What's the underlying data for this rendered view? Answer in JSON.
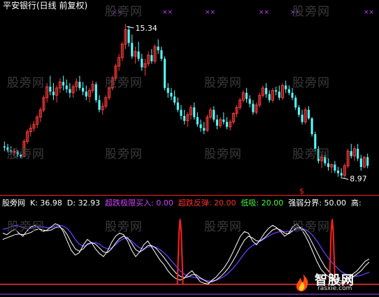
{
  "title": "平安银行(日线 前复权)",
  "watermark": "股旁网",
  "colors": {
    "up": "#ff3b3b",
    "down": "#54ffff",
    "k_line": "#ffffff",
    "d_line": "#ffffff",
    "purple_line": "#6a3cff",
    "spike": "#ff2020",
    "baseline": "#ff3030",
    "sep": "#ff2020",
    "marker": "#c040ff"
  },
  "main_chart": {
    "high_label": "15.34",
    "low_label": "8.97",
    "signal_glyph": "$",
    "top_marker": "××",
    "y_range": [
      8.5,
      15.8
    ],
    "candles": [
      [
        10.3,
        10.5,
        10.1,
        10.25
      ],
      [
        10.25,
        10.4,
        10.05,
        10.15
      ],
      [
        10.15,
        10.3,
        9.95,
        10.05
      ],
      [
        10.05,
        10.2,
        9.9,
        10.1
      ],
      [
        10.1,
        10.15,
        9.85,
        9.95
      ],
      [
        9.95,
        10.05,
        9.8,
        9.88
      ],
      [
        9.88,
        10.6,
        9.85,
        10.5
      ],
      [
        10.5,
        11.0,
        10.4,
        10.9
      ],
      [
        10.9,
        11.2,
        10.7,
        11.05
      ],
      [
        11.05,
        11.35,
        10.9,
        11.2
      ],
      [
        11.2,
        11.6,
        11.05,
        11.5
      ],
      [
        11.5,
        11.9,
        11.3,
        11.8
      ],
      [
        11.8,
        12.4,
        11.7,
        12.3
      ],
      [
        12.3,
        12.9,
        12.1,
        12.75
      ],
      [
        12.75,
        13.2,
        12.4,
        12.55
      ],
      [
        12.55,
        12.9,
        12.2,
        12.4
      ],
      [
        12.4,
        12.8,
        12.1,
        12.7
      ],
      [
        12.7,
        13.1,
        12.5,
        12.95
      ],
      [
        12.95,
        13.2,
        12.6,
        12.8
      ],
      [
        12.8,
        13.05,
        12.5,
        12.65
      ],
      [
        12.65,
        12.9,
        12.3,
        12.5
      ],
      [
        12.5,
        12.85,
        12.3,
        12.75
      ],
      [
        12.75,
        13.1,
        12.55,
        12.95
      ],
      [
        12.95,
        13.2,
        12.6,
        12.7
      ],
      [
        12.7,
        12.95,
        12.4,
        12.55
      ],
      [
        12.55,
        12.8,
        12.2,
        12.35
      ],
      [
        12.35,
        12.7,
        12.1,
        12.6
      ],
      [
        12.6,
        13.0,
        12.5,
        12.85
      ],
      [
        12.85,
        12.95,
        12.1,
        12.2
      ],
      [
        12.2,
        12.4,
        11.7,
        11.8
      ],
      [
        11.8,
        12.1,
        11.6,
        11.95
      ],
      [
        11.95,
        12.4,
        11.85,
        12.3
      ],
      [
        12.3,
        12.8,
        12.2,
        12.7
      ],
      [
        12.7,
        13.2,
        12.6,
        13.1
      ],
      [
        13.1,
        13.7,
        13.0,
        13.6
      ],
      [
        13.6,
        14.1,
        13.4,
        13.95
      ],
      [
        13.95,
        14.6,
        13.8,
        14.5
      ],
      [
        14.5,
        15.34,
        14.3,
        15.1
      ],
      [
        15.1,
        15.25,
        14.4,
        14.55
      ],
      [
        14.55,
        14.9,
        13.9,
        14.0
      ],
      [
        14.0,
        14.4,
        13.7,
        14.2
      ],
      [
        14.2,
        14.6,
        13.8,
        13.9
      ],
      [
        13.9,
        14.1,
        13.4,
        13.55
      ],
      [
        13.55,
        13.9,
        13.2,
        13.7
      ],
      [
        13.7,
        14.2,
        13.6,
        14.05
      ],
      [
        14.05,
        14.3,
        13.7,
        13.8
      ],
      [
        13.8,
        14.5,
        13.7,
        14.4
      ],
      [
        14.4,
        14.7,
        14.1,
        14.25
      ],
      [
        14.25,
        14.4,
        13.8,
        13.9
      ],
      [
        13.9,
        14.0,
        12.6,
        12.7
      ],
      [
        12.7,
        12.9,
        12.3,
        12.5
      ],
      [
        12.5,
        12.7,
        12.2,
        12.35
      ],
      [
        12.35,
        12.6,
        12.0,
        12.1
      ],
      [
        12.1,
        12.3,
        11.7,
        11.8
      ],
      [
        11.8,
        12.0,
        11.4,
        11.55
      ],
      [
        11.55,
        11.8,
        11.2,
        11.35
      ],
      [
        11.35,
        11.7,
        11.1,
        11.6
      ],
      [
        11.6,
        12.0,
        11.4,
        11.9
      ],
      [
        11.9,
        12.1,
        11.4,
        11.5
      ],
      [
        11.5,
        11.7,
        11.1,
        11.2
      ],
      [
        11.2,
        11.4,
        10.9,
        11.05
      ],
      [
        11.05,
        11.3,
        10.8,
        10.95
      ],
      [
        10.95,
        11.6,
        10.9,
        11.5
      ],
      [
        11.5,
        11.9,
        11.4,
        11.8
      ],
      [
        11.8,
        11.95,
        11.3,
        11.4
      ],
      [
        11.4,
        11.6,
        11.0,
        11.15
      ],
      [
        11.15,
        11.5,
        11.05,
        11.4
      ],
      [
        11.4,
        11.7,
        11.2,
        11.3
      ],
      [
        11.3,
        11.5,
        11.0,
        11.1
      ],
      [
        11.1,
        11.4,
        10.95,
        11.3
      ],
      [
        11.3,
        11.7,
        11.2,
        11.65
      ],
      [
        11.65,
        12.0,
        11.5,
        11.9
      ],
      [
        11.9,
        12.3,
        11.8,
        12.2
      ],
      [
        12.2,
        12.6,
        12.1,
        12.5
      ],
      [
        12.5,
        12.7,
        12.1,
        12.25
      ],
      [
        12.25,
        12.4,
        11.9,
        12.05
      ],
      [
        12.05,
        12.2,
        11.6,
        11.7
      ],
      [
        11.7,
        12.1,
        11.6,
        12.0
      ],
      [
        12.0,
        12.5,
        11.9,
        12.4
      ],
      [
        12.4,
        12.8,
        12.3,
        12.7
      ],
      [
        12.7,
        12.9,
        12.3,
        12.45
      ],
      [
        12.45,
        12.6,
        12.1,
        12.2
      ],
      [
        12.2,
        12.7,
        12.1,
        12.6
      ],
      [
        12.6,
        12.75,
        12.4,
        12.55
      ],
      [
        12.55,
        12.8,
        12.2,
        12.3
      ],
      [
        12.3,
        12.9,
        12.2,
        12.8
      ],
      [
        12.8,
        13.0,
        12.5,
        12.65
      ],
      [
        12.65,
        12.8,
        12.4,
        12.5
      ],
      [
        12.5,
        12.7,
        12.2,
        12.3
      ],
      [
        12.3,
        12.4,
        11.8,
        11.9
      ],
      [
        11.9,
        12.0,
        11.5,
        11.6
      ],
      [
        11.6,
        11.8,
        11.2,
        11.3
      ],
      [
        11.3,
        11.9,
        11.2,
        11.8
      ],
      [
        11.8,
        11.95,
        11.4,
        11.45
      ],
      [
        11.45,
        11.5,
        10.7,
        10.8
      ],
      [
        10.8,
        10.9,
        10.1,
        10.2
      ],
      [
        10.2,
        10.3,
        9.6,
        9.7
      ],
      [
        9.7,
        9.95,
        9.4,
        9.85
      ],
      [
        9.85,
        9.95,
        9.5,
        9.6
      ],
      [
        9.6,
        9.8,
        9.3,
        9.45
      ],
      [
        9.45,
        9.6,
        9.2,
        9.55
      ],
      [
        9.55,
        9.7,
        9.2,
        9.3
      ],
      [
        9.3,
        9.45,
        9.05,
        9.2
      ],
      [
        9.2,
        9.4,
        8.97,
        9.1
      ],
      [
        9.1,
        9.6,
        9.0,
        9.5
      ],
      [
        9.5,
        10.2,
        9.4,
        10.1
      ],
      [
        10.1,
        10.4,
        9.8,
        9.9
      ],
      [
        9.9,
        10.3,
        9.7,
        10.2
      ],
      [
        10.2,
        10.4,
        9.7,
        9.8
      ],
      [
        9.8,
        9.95,
        9.3,
        9.45
      ],
      [
        9.45,
        9.9,
        9.4,
        9.85
      ],
      [
        9.85,
        10.0,
        9.4,
        9.5
      ]
    ]
  },
  "indicator": {
    "name": "股旁网",
    "k_label": "K:",
    "k_value": "36.98",
    "d_label": "D:",
    "d_value": "32.93",
    "s1_label": "超跌极限买入:",
    "s1_value": "0.00",
    "s2_label": "超跌反弹:",
    "s2_value": "20.00",
    "s3_label": "低吸:",
    "s3_value": "20.00",
    "s4_label": "强弱分界:",
    "s4_value": "50.00",
    "s5_label": "高:",
    "range": [
      0,
      100
    ],
    "spike_positions": [
      0.484,
      0.899
    ],
    "k_series": [
      70,
      68,
      72,
      75,
      70,
      66,
      73,
      78,
      80,
      76,
      72,
      74,
      78,
      82,
      80,
      72,
      60,
      48,
      42,
      45,
      55,
      62,
      58,
      50,
      44,
      40,
      47,
      58,
      66,
      70,
      68,
      60,
      48,
      40,
      46,
      55,
      60,
      52,
      44,
      36,
      30,
      22,
      16,
      12,
      10,
      12,
      18,
      22,
      15,
      8,
      6,
      5,
      10,
      14,
      20,
      26,
      34,
      44,
      55,
      66,
      72,
      70,
      60,
      55,
      62,
      70,
      76,
      80,
      77,
      72,
      66,
      70,
      78,
      82,
      76,
      68,
      58,
      46,
      34,
      24,
      18,
      14,
      10,
      8,
      6,
      9,
      14,
      18,
      22,
      28,
      34,
      37
    ],
    "d_series": [
      62,
      64,
      66,
      68,
      69,
      68,
      69,
      71,
      74,
      75,
      74,
      73,
      74,
      77,
      78,
      75,
      68,
      58,
      50,
      47,
      50,
      56,
      58,
      56,
      51,
      46,
      45,
      50,
      57,
      63,
      66,
      64,
      57,
      49,
      46,
      49,
      54,
      54,
      51,
      45,
      39,
      32,
      25,
      19,
      15,
      13,
      14,
      17,
      17,
      13,
      10,
      7,
      8,
      10,
      14,
      19,
      25,
      33,
      42,
      52,
      61,
      66,
      64,
      60,
      60,
      64,
      69,
      74,
      76,
      74,
      70,
      69,
      73,
      77,
      77,
      73,
      66,
      56,
      46,
      36,
      27,
      21,
      16,
      12,
      9,
      9,
      11,
      14,
      18,
      22,
      28,
      33
    ],
    "purple_series": [
      75,
      76,
      78,
      80,
      79,
      77,
      76,
      76,
      78,
      79,
      78,
      77,
      77,
      79,
      80,
      79,
      76,
      70,
      62,
      56,
      53,
      55,
      57,
      58,
      56,
      52,
      50,
      51,
      55,
      60,
      63,
      63,
      60,
      55,
      51,
      50,
      52,
      53,
      52,
      49,
      45,
      40,
      34,
      28,
      22,
      18,
      15,
      14,
      13,
      12,
      10,
      9,
      9,
      10,
      12,
      15,
      19,
      24,
      30,
      37,
      44,
      50,
      54,
      57,
      60,
      63,
      66,
      69,
      71,
      72,
      72,
      72,
      73,
      75,
      76,
      75,
      72,
      67,
      60,
      52,
      44,
      37,
      31,
      26,
      21,
      18,
      16,
      15,
      15,
      16,
      18,
      20
    ]
  }
}
